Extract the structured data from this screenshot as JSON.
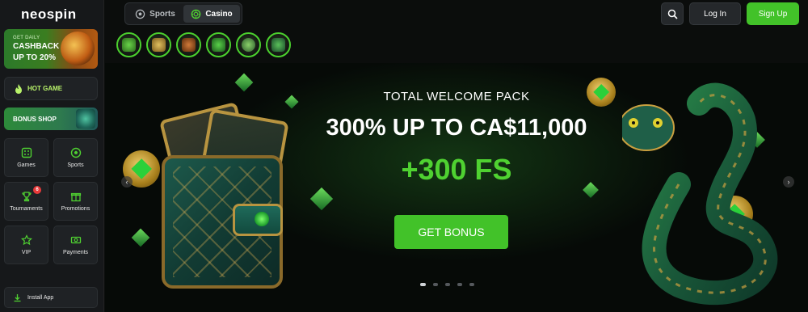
{
  "brand": {
    "logo_text": "neospin"
  },
  "sidebar": {
    "cashback": {
      "line1": "GET DAILY",
      "line2": "CASHBACK",
      "line3": "UP TO 20%"
    },
    "hot_game": {
      "label": "HOT GAME",
      "icon": "flame-icon"
    },
    "bonus_shop": {
      "label": "BONUS SHOP"
    },
    "tiles": [
      {
        "label": "Games",
        "icon": "dice-icon"
      },
      {
        "label": "Sports",
        "icon": "soccer-ball-icon"
      },
      {
        "label": "Tournaments",
        "icon": "trophy-icon",
        "badge": "6"
      },
      {
        "label": "Promotions",
        "icon": "gift-icon"
      },
      {
        "label": "VIP",
        "icon": "star-icon"
      },
      {
        "label": "Payments",
        "icon": "money-icon"
      }
    ],
    "install": {
      "label": "Install App",
      "icon": "download-icon"
    }
  },
  "topbar": {
    "tabs": [
      {
        "label": "Sports",
        "icon": "soccer-ball-icon",
        "active": false
      },
      {
        "label": "Casino",
        "icon": "casino-chip-icon",
        "active": true
      }
    ],
    "search_icon": "search-icon",
    "login_label": "Log In",
    "signup_label": "Sign Up"
  },
  "categories": [
    "trophy-category",
    "crown-category",
    "slot-category",
    "gift-category",
    "live-category",
    "bonus-category"
  ],
  "hero": {
    "subtitle": "TOTAL WELCOME PACK",
    "title": "300% UP TO CA$11,000",
    "free_spins": "+300 FS",
    "cta": "GET BONUS",
    "slides_count": 5,
    "active_slide": 1
  },
  "colors": {
    "accent": "#42c229",
    "badge": "#e83a3a",
    "background": "#0b0d0c"
  }
}
